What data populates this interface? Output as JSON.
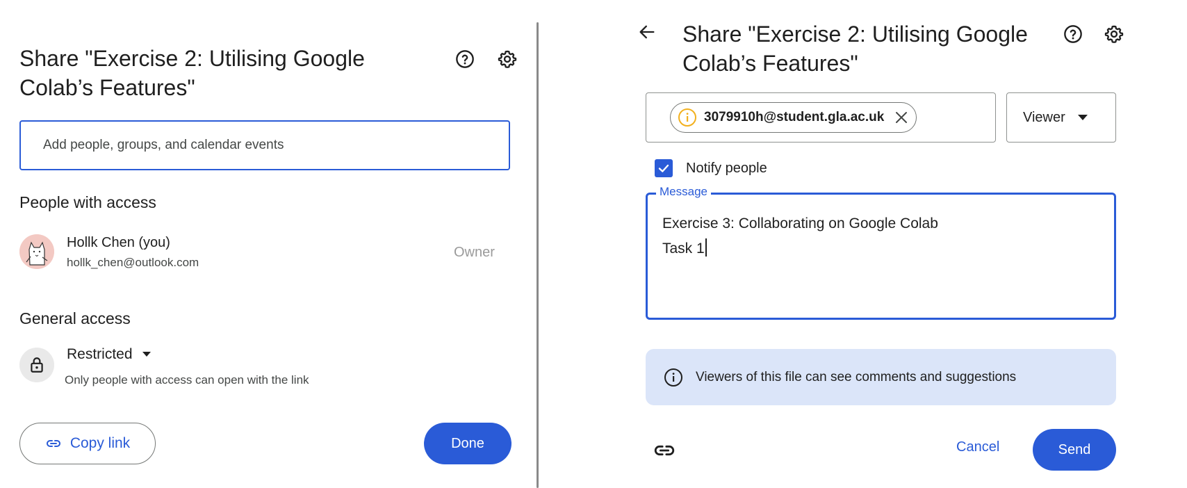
{
  "left_dialog": {
    "title_line1": "Share \"Exercise 2: Utilising Google",
    "title_line2": "Colab’s Features\"",
    "add_people_placeholder": "Add people, groups, and calendar events",
    "people_heading": "People with access",
    "person": {
      "name": "Hollk Chen (you)",
      "email": "hollk_chen@outlook.com",
      "role": "Owner"
    },
    "general_access_heading": "General access",
    "access_level": "Restricted",
    "access_description": "Only people with access can open with the link",
    "copy_link_label": "Copy link",
    "done_label": "Done"
  },
  "right_dialog": {
    "title_line1": "Share \"Exercise 2: Utilising Google",
    "title_line2": "Colab’s Features\"",
    "recipient_chip": "3079910h@student.gla.ac.uk",
    "role": "Viewer",
    "notify_label": "Notify people",
    "notify_checked": true,
    "message_label": "Message",
    "message_line1": "Exercise 3: Collaborating on Google Colab",
    "message_line2": "Task 1",
    "info_text": "Viewers of this file can see comments and suggestions",
    "cancel_label": "Cancel",
    "send_label": "Send"
  },
  "colors": {
    "accent": "#2a5bd7",
    "info_banner": "#dbe5f9",
    "warning": "#f2b01e"
  },
  "icons": [
    "help-icon",
    "gear-icon",
    "back-arrow-icon",
    "lock-icon",
    "dropdown-icon",
    "link-icon",
    "info-icon",
    "warning-icon",
    "close-icon",
    "check-icon"
  ]
}
